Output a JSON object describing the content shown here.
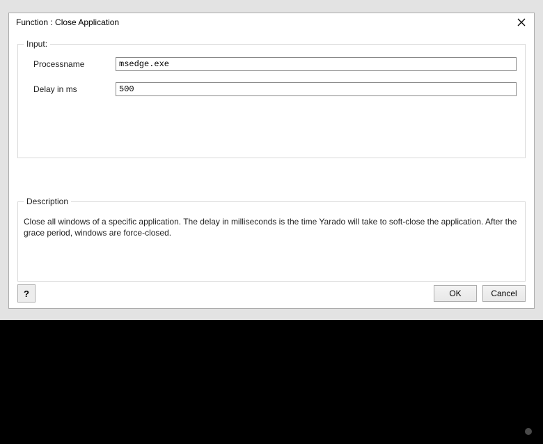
{
  "dialog": {
    "title": "Function : Close Application"
  },
  "input_group": {
    "legend": "Input:",
    "processname": {
      "label": "Processname",
      "value": "msedge.exe"
    },
    "delay": {
      "label": "Delay in ms",
      "value": "500"
    }
  },
  "description_group": {
    "legend": "Description",
    "text": "Close all windows of a specific application. The delay in milliseconds is the time Yarado will take to soft-close the application. After the grace period, windows are force-closed."
  },
  "buttons": {
    "help": "?",
    "ok": "OK",
    "cancel": "Cancel"
  }
}
